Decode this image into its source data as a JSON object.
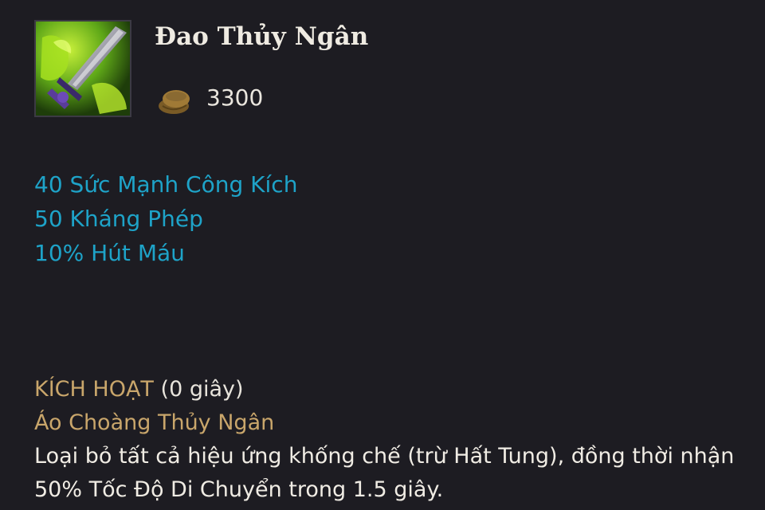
{
  "item": {
    "name": "Đao Thủy Ngân",
    "price": "3300",
    "icon": "mercurial-scimitar-icon",
    "gold_icon": "gold-coin-icon"
  },
  "stats": [
    "40 Sức Mạnh Công Kích",
    "50 Kháng Phép",
    "10% Hút Máu"
  ],
  "active": {
    "label": "KÍCH HOẠT",
    "cooldown": "(0 giây)",
    "name": "Áo Choàng Thủy Ngân",
    "description": "Loại bỏ tất cả hiệu ứng khống chế (trừ Hất Tung), đồng thời nhận 50% Tốc Độ Di Chuyển trong 1.5 giây."
  },
  "colors": {
    "background": "#1d1c22",
    "stat_text": "#1ea3c8",
    "active_label": "#c9a66b",
    "gold": "#8a6a32"
  }
}
